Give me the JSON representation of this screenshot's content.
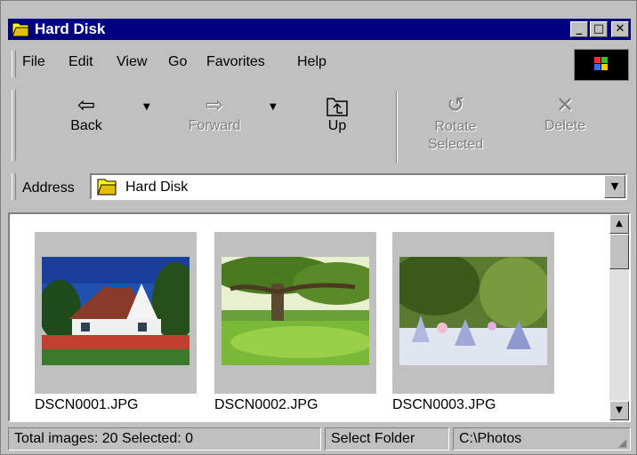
{
  "window": {
    "title": "Hard Disk",
    "buttons": {
      "minimize": "_",
      "maximize": "□",
      "close": "✕"
    }
  },
  "menu": {
    "items": [
      {
        "label": "File"
      },
      {
        "label": "Edit"
      },
      {
        "label": "View"
      },
      {
        "label": "Go"
      },
      {
        "label": "Favorites"
      },
      {
        "label": "Help"
      }
    ]
  },
  "toolbar": {
    "back": {
      "label": "Back",
      "icon": "back-arrow-icon"
    },
    "forward": {
      "label": "Forward",
      "icon": "forward-arrow-icon"
    },
    "up": {
      "label": "Up",
      "icon": "up-folder-icon"
    },
    "rotate": {
      "label_line1": "Rotate",
      "label_line2": "Selected",
      "icon": "rotate-icon"
    },
    "delete": {
      "label": "Delete",
      "icon": "delete-x-icon"
    }
  },
  "address": {
    "label": "Address",
    "value": "Hard Disk"
  },
  "thumbnails": [
    {
      "name": "DSCN0001.JPG"
    },
    {
      "name": "DSCN0002.JPG"
    },
    {
      "name": "DSCN0003.JPG"
    }
  ],
  "status": {
    "summary": "Total images: 20    Selected: 0",
    "action": "Select Folder",
    "path": "C:\\Photos"
  },
  "colors": {
    "title_bar": "#000080",
    "face": "#c0c0c0",
    "folder_yellow": "#ffff00"
  }
}
